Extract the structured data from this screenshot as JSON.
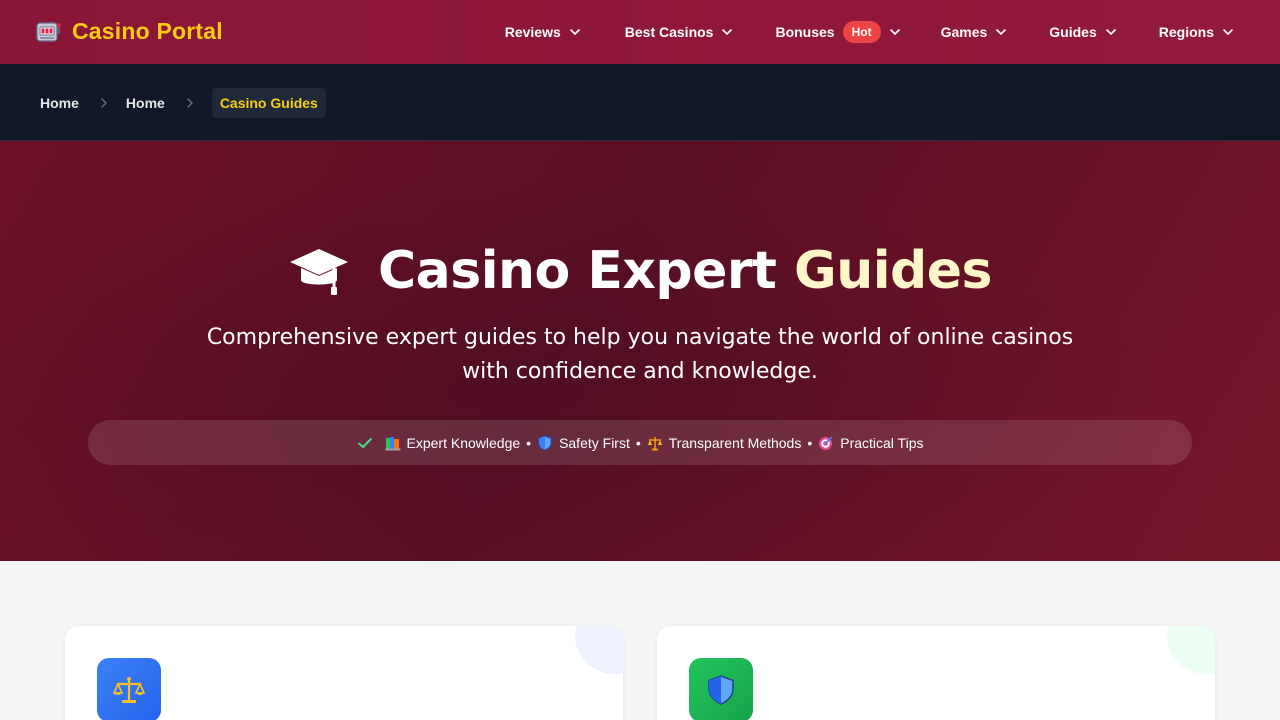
{
  "brand": {
    "name": "Casino Portal",
    "icon": "slot-machine-icon"
  },
  "nav": {
    "items": [
      {
        "label": "Reviews"
      },
      {
        "label": "Best Casinos"
      },
      {
        "label": "Bonuses",
        "badge": "Hot"
      },
      {
        "label": "Games"
      },
      {
        "label": "Guides"
      },
      {
        "label": "Regions"
      }
    ]
  },
  "breadcrumb": {
    "items": [
      "Home",
      "Home"
    ],
    "active": "Casino Guides"
  },
  "hero": {
    "title_main": "Casino Expert",
    "title_highlight": "Guides",
    "subtitle": "Comprehensive expert guides to help you navigate the world of online casinos with confidence and knowledge.",
    "features": [
      "Expert Knowledge",
      "Safety First",
      "Transparent Methods",
      "Practical Tips"
    ],
    "separator": "•"
  },
  "cards": [
    {
      "icon": "scales-icon"
    },
    {
      "icon": "shield-icon"
    }
  ],
  "colors": {
    "nav_bg": "#8a1536",
    "brand_yellow": "#facc15",
    "breadcrumb_bg": "#111827",
    "hero_bg": "#5a0f24",
    "hot_badge": "#ef4444",
    "card_icon_blue": "#2563eb",
    "card_icon_green": "#16a34a"
  }
}
